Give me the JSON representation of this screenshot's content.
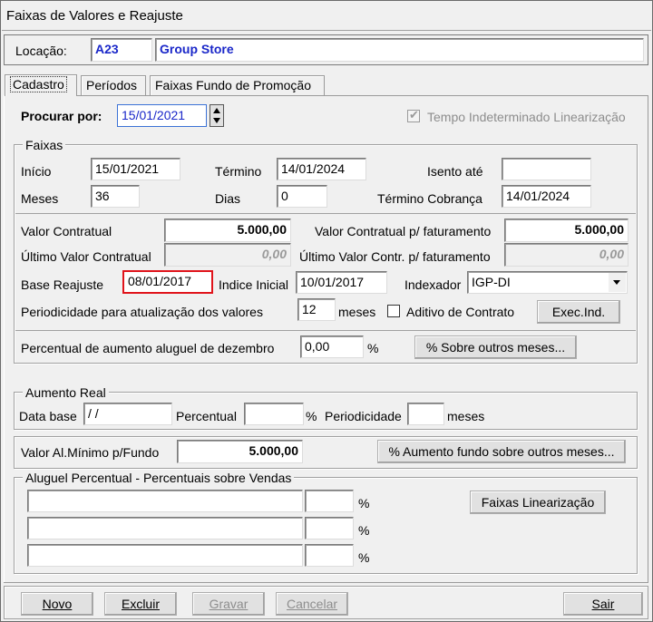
{
  "window": {
    "title": "Faixas de Valores e Reajuste"
  },
  "location": {
    "label": "Locação:",
    "code": "A23",
    "name": "Group Store"
  },
  "tabs": [
    {
      "label": "Cadastro"
    },
    {
      "label": "Períodos"
    },
    {
      "label": "Faixas Fundo de Promoção"
    }
  ],
  "search": {
    "label": "Procurar por:",
    "value": "15/01/2021"
  },
  "indeterminate": {
    "label": "Tempo Indeterminado Linearização",
    "checked": true
  },
  "faixas": {
    "title": "Faixas",
    "inicio_label": "Início",
    "inicio": "15/01/2021",
    "termino_label": "Término",
    "termino": "14/01/2024",
    "isento_label": "Isento até",
    "isento": "",
    "meses_label": "Meses",
    "meses": "36",
    "dias_label": "Dias",
    "dias": "0",
    "termino_cobranca_label": "Término Cobrança",
    "termino_cobranca": "14/01/2024",
    "valor_contratual_label": "Valor Contratual",
    "valor_contratual": "5.000,00",
    "valor_fat_label": "Valor Contratual p/ faturamento",
    "valor_fat": "5.000,00",
    "ultimo_valor_label": "Último Valor Contratual",
    "ultimo_valor": "0,00",
    "ultimo_fat_label": "Último Valor Contr. p/ faturamento",
    "ultimo_fat": "0,00",
    "base_reajuste_label": "Base Reajuste",
    "base_reajuste": "08/01/2017",
    "indice_inicial_label": "Indice Inicial",
    "indice_inicial": "10/01/2017",
    "indexador_label": "Indexador",
    "indexador": "IGP-DI",
    "periodicidade_label": "Periodicidade para atualização dos valores",
    "periodicidade": "12",
    "meses_suffix": "meses",
    "aditivo_label": "Aditivo de Contrato",
    "exec_ind": "Exec.Ind.",
    "percentual_dez_label": "Percentual de aumento aluguel de dezembro",
    "percentual_dez": "0,00",
    "pct": "%",
    "outros_meses": "% Sobre outros meses..."
  },
  "aumento_real": {
    "title": "Aumento Real",
    "data_base_label": "Data base",
    "data_base": " / /",
    "percentual_label": "Percentual",
    "percentual": "",
    "pct": "%",
    "periodicidade_label": "Periodicidade",
    "periodicidade": "",
    "meses": "meses"
  },
  "fundo": {
    "label": "Valor Al.Mínimo p/Fundo",
    "value": "5.000,00",
    "button": "% Aumento fundo sobre outros meses..."
  },
  "aluguel_percentual": {
    "title": "Aluguel Percentual - Percentuais sobre Vendas",
    "rows": [
      {
        "desc": "",
        "pct": ""
      },
      {
        "desc": "",
        "pct": ""
      },
      {
        "desc": "",
        "pct": ""
      }
    ],
    "pct_symbol": "%",
    "button": "Faixas Linearização"
  },
  "footer": {
    "novo": "Novo",
    "excluir": "Excluir",
    "gravar": "Gravar",
    "cancelar": "Cancelar",
    "sair": "Sair"
  },
  "colors": {
    "highlight": "#e0141b",
    "link_blue": "#1a27c9"
  }
}
